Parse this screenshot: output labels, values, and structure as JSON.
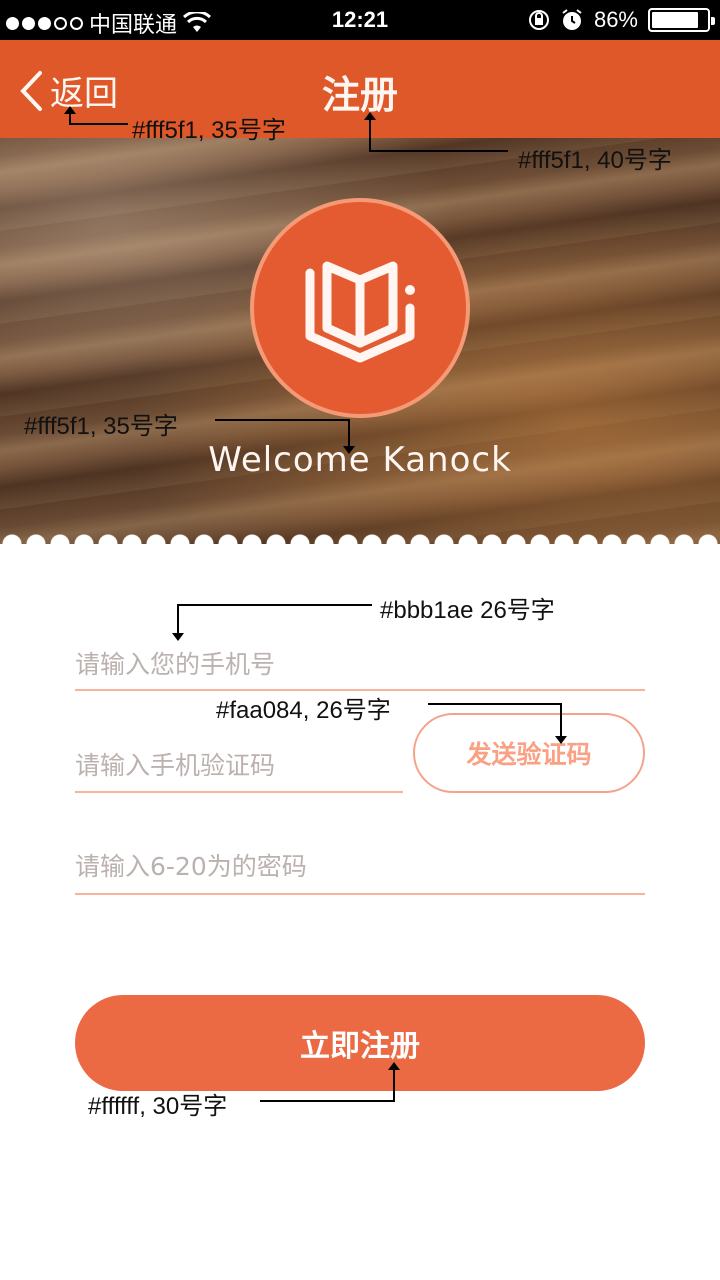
{
  "status_bar": {
    "carrier": "中国联通",
    "time": "12:21",
    "battery": "86%",
    "battery_level": 0.86
  },
  "nav": {
    "back_label": "返回",
    "title": "注册"
  },
  "hero": {
    "welcome": "Welcome  Kanock"
  },
  "form": {
    "phone_placeholder": "请输入您的手机号",
    "code_placeholder": "请输入手机验证码",
    "send_code_label": "发送验证码",
    "password_placeholder": "请输入6-20为的密码",
    "register_label": "立即注册"
  },
  "annotations": {
    "back_note": "#fff5f1, 35号字",
    "title_note": "#fff5f1, 40号字",
    "welcome_note": "#fff5f1, 35号字",
    "placeholder_note": "#bbb1ae 26号字",
    "send_note": "#faa084, 26号字",
    "register_note": "#ffffff, 30号字"
  },
  "colors": {
    "nav_bg": "#de582a",
    "logo_bg": "#e45b32",
    "accent": "#ec6a43",
    "placeholder": "#bbb1ae",
    "send_text": "#faa084",
    "title_text": "#fff5f1"
  }
}
